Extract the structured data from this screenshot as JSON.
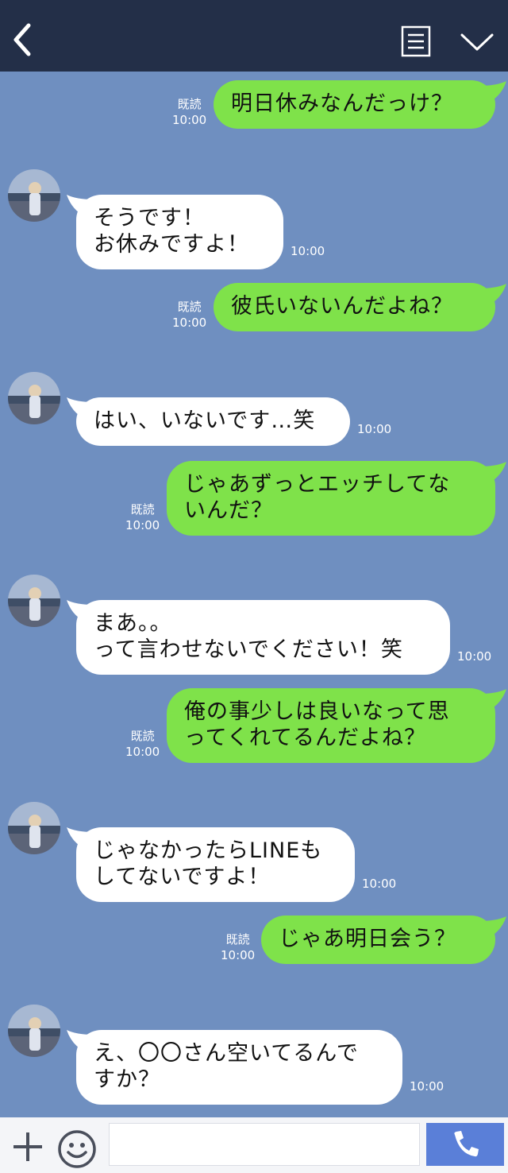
{
  "header": {
    "back_icon": "chevron-left-icon",
    "menu_icon": "list-icon",
    "collapse_icon": "chevron-down-icon"
  },
  "messages": [
    {
      "from": "me",
      "text": "明日休みなんだっけ？",
      "read": "既読",
      "time": "10:00"
    },
    {
      "from": "them",
      "text": "そうです！\nお休みですよ！",
      "time": "10:00"
    },
    {
      "from": "me",
      "text": "彼氏いないんだよね？",
      "read": "既読",
      "time": "10:00"
    },
    {
      "from": "them",
      "text": "はい、いないです…笑",
      "time": "10:00"
    },
    {
      "from": "me",
      "text": "じゃあずっとエッチしてな\nいんだ？",
      "read": "既読",
      "time": "10:00"
    },
    {
      "from": "them",
      "text": "まあ。。\nって言わせないでください！笑",
      "time": "10:00"
    },
    {
      "from": "me",
      "text": "俺の事少しは良いなって思\nってくれてるんだよね？",
      "read": "既読",
      "time": "10:00"
    },
    {
      "from": "them",
      "text": "じゃなかったらLINEも\nしてないですよ！",
      "time": "10:00"
    },
    {
      "from": "me",
      "text": "じゃあ明日会う？",
      "read": "既読",
      "time": "10:00"
    },
    {
      "from": "them",
      "text": "え、〇〇さん空いてるんで\nすか？",
      "time": "10:00"
    }
  ],
  "footer": {
    "plus_icon": "plus-icon",
    "emoji_icon": "smiley-icon",
    "input_placeholder": "",
    "call_icon": "phone-icon"
  },
  "colors": {
    "header": "#232f48",
    "background": "#6f8fc0",
    "my_bubble": "#7fe24a",
    "their_bubble": "#ffffff",
    "call_button": "#5a7fd8"
  }
}
